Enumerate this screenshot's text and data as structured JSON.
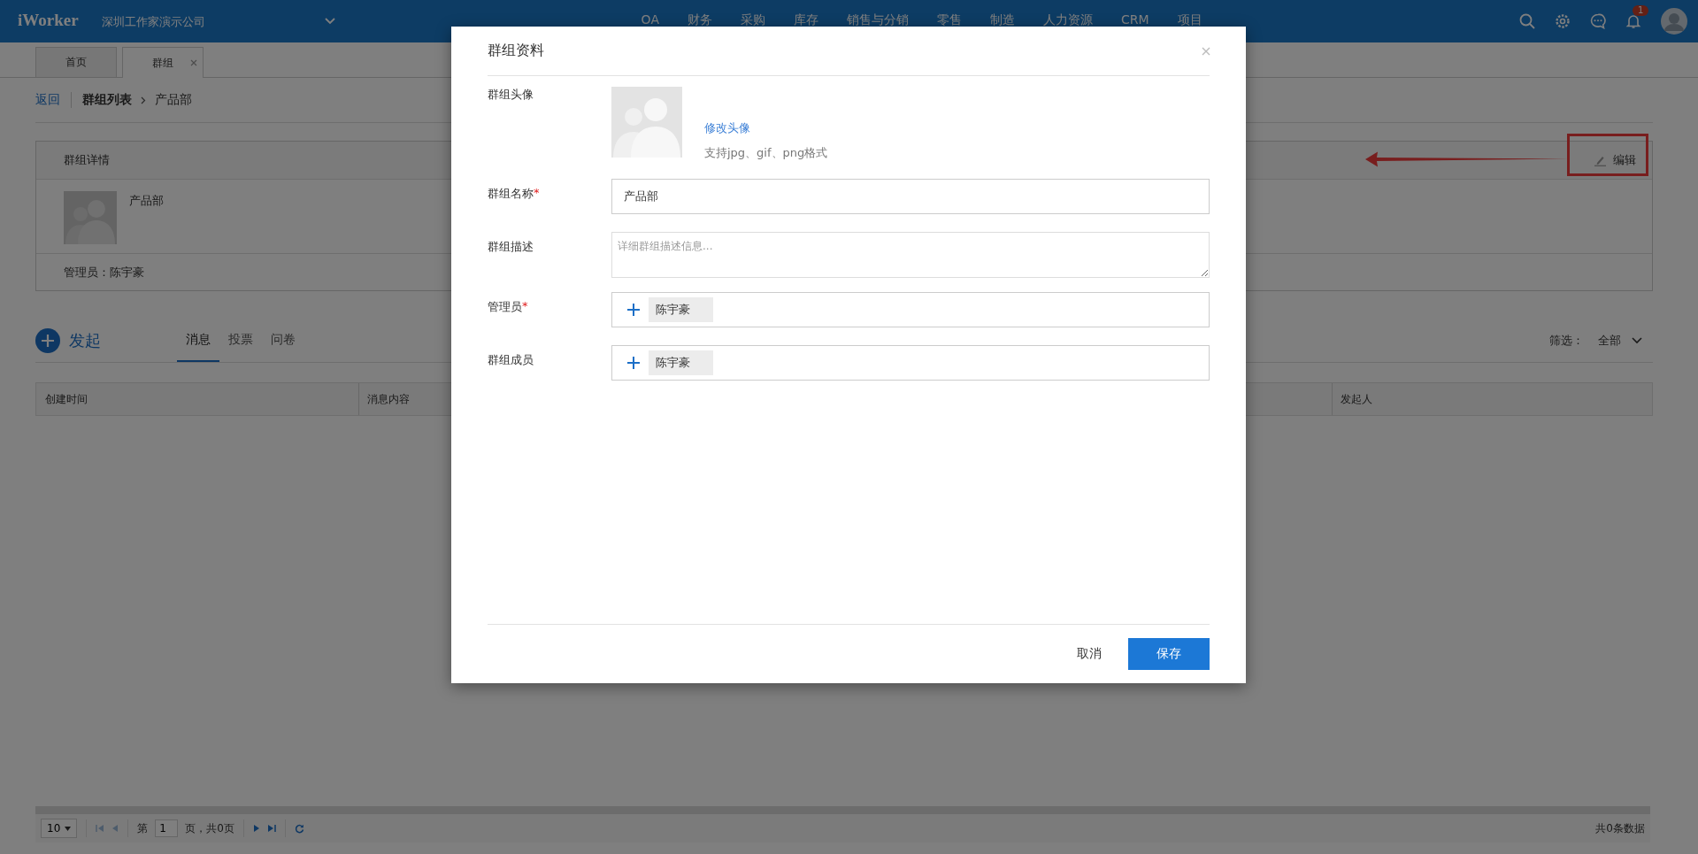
{
  "top_bar": {
    "logo": "iWorker",
    "company": "深圳工作家演示公司",
    "nav": [
      "OA",
      "财务",
      "采购",
      "库存",
      "销售与分销",
      "零售",
      "制造",
      "人力资源",
      "CRM",
      "项目"
    ],
    "notification_count": "1"
  },
  "page_tabs": [
    {
      "label": "首页",
      "selected": false,
      "closable": false
    },
    {
      "label": "群组",
      "selected": true,
      "closable": true
    }
  ],
  "breadcrumb": {
    "back": "返回",
    "items": [
      "群组列表",
      "产品部"
    ]
  },
  "group_detail": {
    "title": "群组详情",
    "edit": "编辑",
    "name": "产品部",
    "admin": "管理员：陈宇豪"
  },
  "feed": {
    "launch": "发起",
    "tabs": [
      {
        "label": "消息",
        "selected": true
      },
      {
        "label": "投票",
        "selected": false
      },
      {
        "label": "问卷",
        "selected": false
      }
    ],
    "filter_label": "筛选：",
    "filter_value": "全部"
  },
  "table": {
    "columns": [
      "创建时间",
      "消息内容",
      "发起人"
    ]
  },
  "pagination": {
    "page_size": "10",
    "page_prefix": "第",
    "page": "1",
    "page_suffix": "页，共0页",
    "total": "共0条数据"
  },
  "modal": {
    "title": "群组资料",
    "fields": [
      {
        "kind": "avatar",
        "label": "群组头像",
        "link": "修改头像",
        "hint": "支持jpg、gif、png格式"
      },
      {
        "kind": "text",
        "label": "群组名称",
        "marker": "*",
        "value": "产品部"
      },
      {
        "kind": "textarea",
        "label": "群组描述",
        "placeholder": "详细群组描述信息..."
      },
      {
        "kind": "people",
        "label": "管理员",
        "marker": "*",
        "people": [
          "陈宇豪"
        ]
      },
      {
        "kind": "people",
        "label": "群组成员",
        "people": [
          "陈宇豪"
        ]
      }
    ],
    "buttons": [
      {
        "label": "取消",
        "kind": "secondary"
      },
      {
        "label": "保存",
        "kind": "primary"
      }
    ]
  }
}
